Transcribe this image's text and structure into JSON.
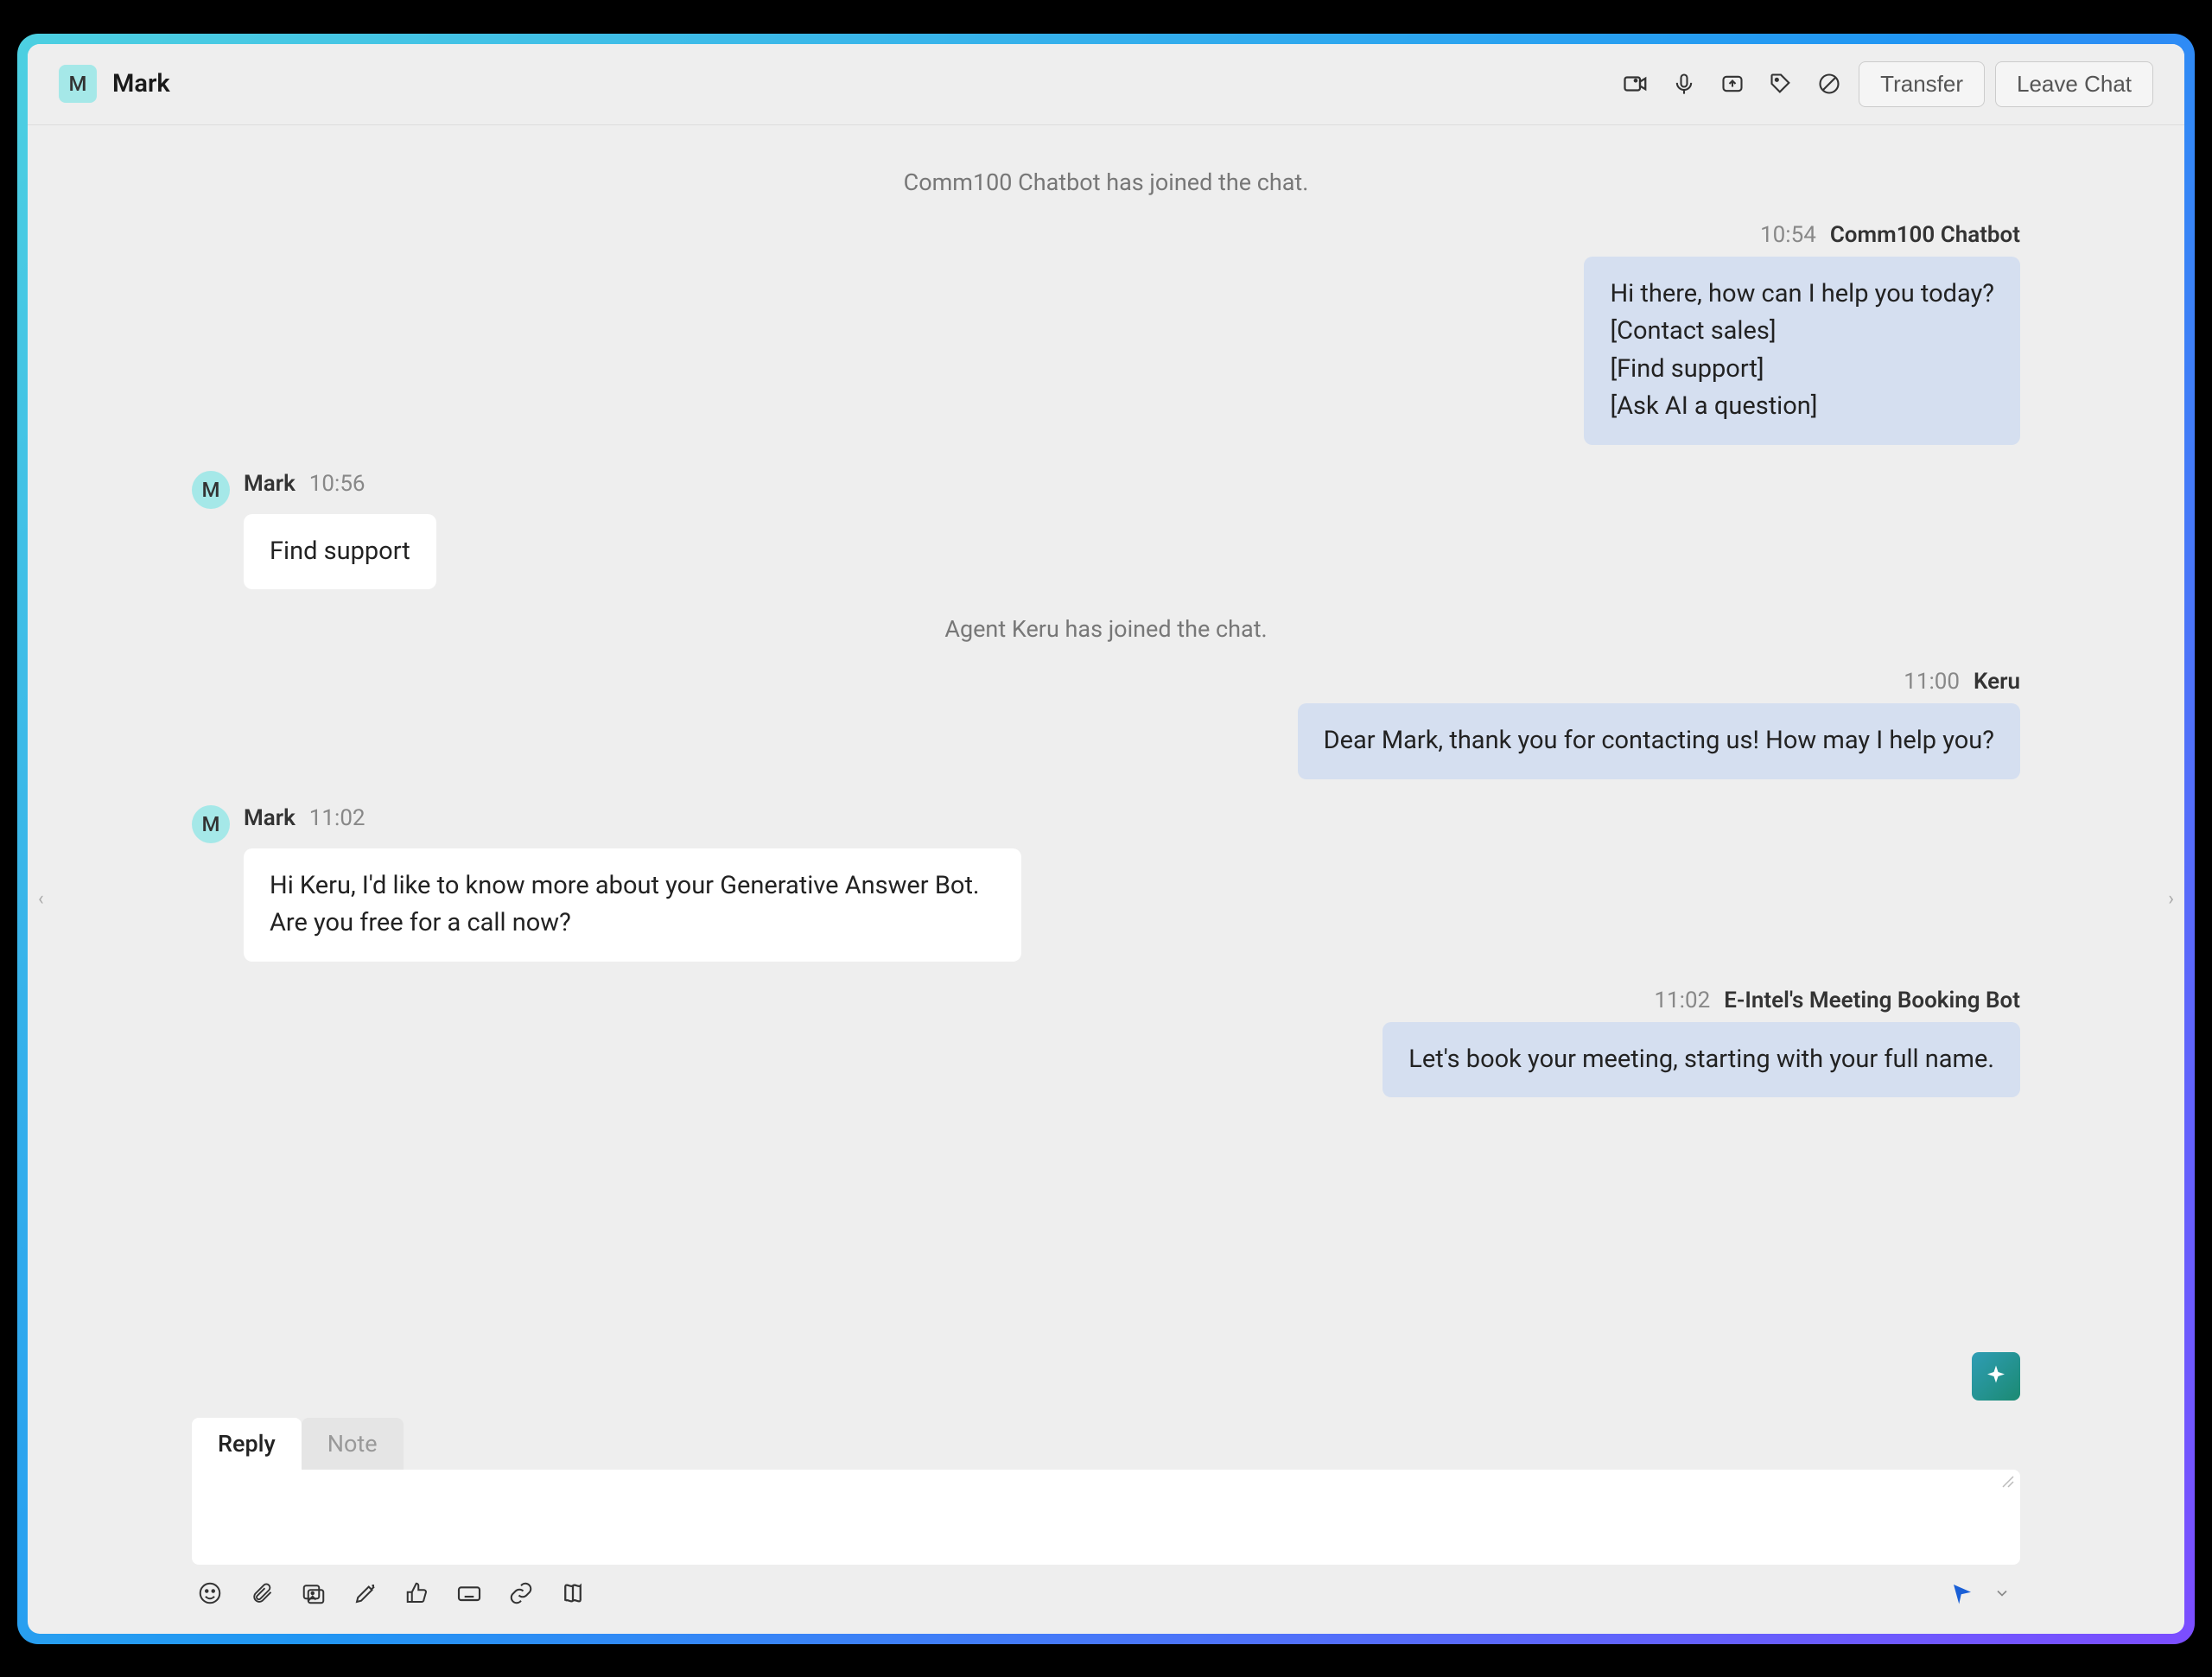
{
  "header": {
    "avatar_letter": "M",
    "title": "Mark",
    "transfer_label": "Transfer",
    "leave_label": "Leave Chat"
  },
  "chat": {
    "system_messages": [
      "Comm100 Chatbot has joined the chat.",
      "Agent Keru has joined the chat."
    ],
    "messages": [
      {
        "side": "right",
        "time": "10:54",
        "name": "Comm100 Chatbot",
        "text": "Hi there, how can I help you today?\n[Contact sales]\n[Find support]\n[Ask AI a question]"
      },
      {
        "side": "left",
        "avatar": "M",
        "name": "Mark",
        "time": "10:56",
        "text": "Find support"
      },
      {
        "side": "right",
        "time": "11:00",
        "name": "Keru",
        "text": "Dear Mark, thank you for contacting us! How may I help you?"
      },
      {
        "side": "left",
        "avatar": "M",
        "name": "Mark",
        "time": "11:02",
        "text": "Hi Keru, I'd like to know more about your Generative Answer Bot. Are you free for a call now?"
      },
      {
        "side": "right",
        "time": "11:02",
        "name": "E-Intel's Meeting Booking Bot",
        "text": "Let's book your meeting, starting with your full name."
      }
    ]
  },
  "composer": {
    "tabs": {
      "reply": "Reply",
      "note": "Note"
    }
  }
}
